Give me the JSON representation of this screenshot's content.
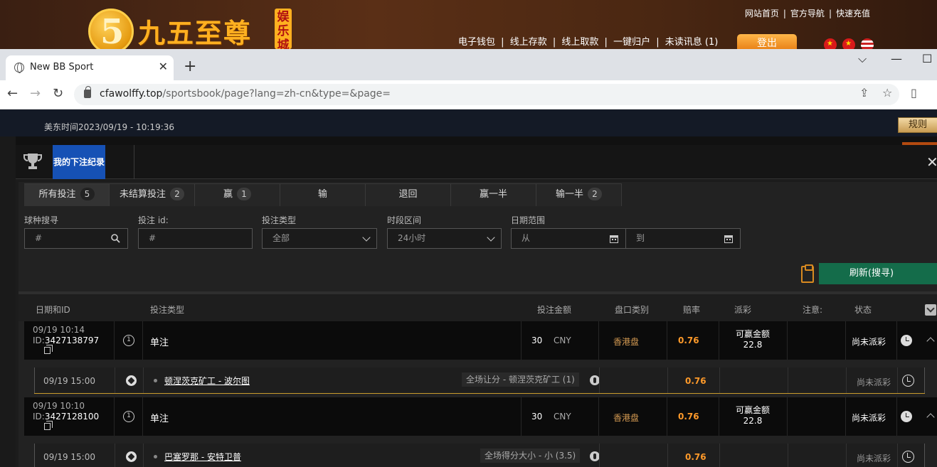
{
  "site": {
    "logo_digit": "5",
    "logo_text": "九五至尊",
    "logo_badge": "娱乐城",
    "top_links": [
      "网站首页",
      "官方导航",
      "快速充值"
    ],
    "main_links": [
      "电子钱包",
      "线上存款",
      "线上取款",
      "一键归户",
      "未读讯息 (1)"
    ],
    "login_label": "登出",
    "separator": "|"
  },
  "browser": {
    "tab_title": "New BB Sport",
    "tab_close": "✕",
    "new_tab": "+",
    "url_host": "cfawolffy.top",
    "url_path": "/sportsbook/page?lang=zh-cn&type=&page=",
    "win_controls": [
      "⌵",
      "—",
      "☐"
    ],
    "nav": [
      "←",
      "→",
      "↻"
    ],
    "addr_icons": [
      "⇪",
      "☆",
      "▯"
    ]
  },
  "page": {
    "time_text": "美东时间2023/09/19 - 10:19:36",
    "rules_label": "规则"
  },
  "modal": {
    "title": "我的下注纪录",
    "close": "✕",
    "tabs": [
      {
        "label": "所有投注",
        "count": "5"
      },
      {
        "label": "未结算投注",
        "count": "2"
      },
      {
        "label": "赢",
        "count": "1"
      },
      {
        "label": "输",
        "count": ""
      },
      {
        "label": "退回",
        "count": ""
      },
      {
        "label": "赢一半",
        "count": ""
      },
      {
        "label": "输一半",
        "count": "2"
      }
    ],
    "filters": {
      "sport_label": "球种搜寻",
      "sport_placeholder": "#",
      "betid_label": "投注 id:",
      "betid_placeholder": "#",
      "bettype_label": "投注类型",
      "bettype_value": "全部",
      "period_label": "时段区间",
      "period_value": "24小时",
      "date_label": "日期范围",
      "date_from": "从",
      "date_to": "到"
    },
    "refresh_label": "刷新(搜寻)",
    "columns": {
      "date_id": "日期和ID",
      "bet_type": "投注类型",
      "amount": "投注金额",
      "market": "盘口类别",
      "odds": "赔率",
      "payout": "派彩",
      "note": "注意:",
      "status": "状态"
    },
    "bets": [
      {
        "date": "09/19 10:14",
        "id_prefix": "ID:",
        "id": "3427138797",
        "num": "1",
        "type": "单注",
        "amount": "30",
        "currency": "CNY",
        "market": "香港盘",
        "odds": "0.76",
        "win_label": "可赢金额",
        "win_amount": "22.8",
        "status": "尚未派彩",
        "leg": {
          "date": "09/19 15:00",
          "match": "顿涅茨克矿工 - 波尔图",
          "market": "全场让分 - 顿涅茨克矿工 (1)",
          "odds": "0.76",
          "status": "尚未派彩"
        }
      },
      {
        "date": "09/19 10:10",
        "id_prefix": "ID:",
        "id": "3427128100",
        "num": "1",
        "type": "单注",
        "amount": "30",
        "currency": "CNY",
        "market": "香港盘",
        "odds": "0.76",
        "win_label": "可赢金额",
        "win_amount": "22.8",
        "status": "尚未派彩",
        "leg": {
          "date": "09/19 15:00",
          "match": "巴塞罗那 - 安特卫普",
          "market": "全场得分大小 - 小 (3.5)",
          "odds": "0.76",
          "status": "尚未派彩"
        }
      }
    ]
  }
}
